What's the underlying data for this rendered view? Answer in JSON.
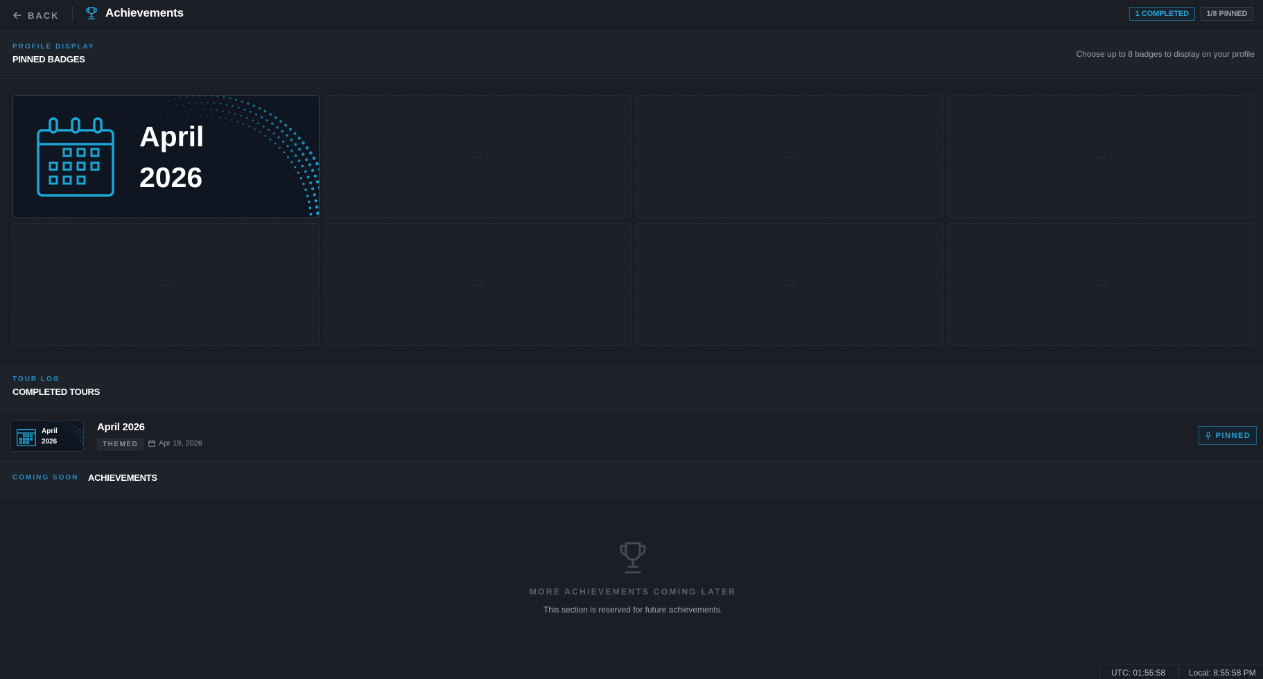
{
  "header": {
    "back_label": "BACK",
    "title": "Achievements",
    "completed_chip": "1 COMPLETED",
    "pinned_chip": "1/8 PINNED"
  },
  "profile_display": {
    "kicker": "PROFILE DISPLAY",
    "title": "PINNED BADGES",
    "note": "Choose up to 8 badges to display on your profile",
    "pinned_badge": {
      "month": "April",
      "year": "2026",
      "icon": "calendar-icon"
    },
    "empty_slot_label": "---",
    "accent_color": "#1ba7d6"
  },
  "tour_log": {
    "kicker": "TOUR LOG",
    "title": "COMPLETED TOURS",
    "tours": [
      {
        "thumb_month": "April",
        "thumb_year": "2026",
        "name": "April 2026",
        "tag": "THEMED",
        "date": "Apr 19, 2026",
        "pin_label": "PINNED"
      }
    ]
  },
  "coming_soon": {
    "kicker": "COMING SOON",
    "title": "ACHIEVEMENTS",
    "empty_title": "MORE ACHIEVEMENTS COMING LATER",
    "empty_sub": "This section is reserved for future achievements."
  },
  "status": {
    "utc": "UTC: 01:55:58",
    "local": "Local: 8:55:58 PM"
  }
}
